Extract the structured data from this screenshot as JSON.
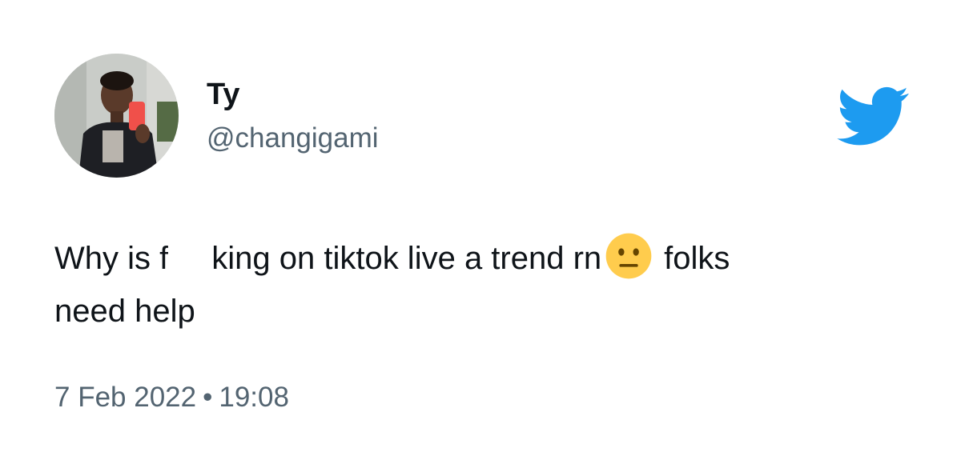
{
  "tweet": {
    "author": {
      "display_name": "Ty",
      "handle": "@changigami",
      "avatar_icon": "user-avatar-photo"
    },
    "platform_icon": "twitter-bird-icon",
    "text": {
      "part1": "Why is f",
      "part2": "king on tiktok live a trend rn",
      "emoji": "neutral-face-emoji",
      "part3": "folks",
      "line2": "need help"
    },
    "date": "7 Feb 2022",
    "separator": "•",
    "time": "19:08"
  },
  "colors": {
    "text_primary": "#0f1419",
    "text_secondary": "#536471",
    "twitter_blue": "#1d9bf0",
    "emoji_yellow": "#ffcc4d"
  }
}
